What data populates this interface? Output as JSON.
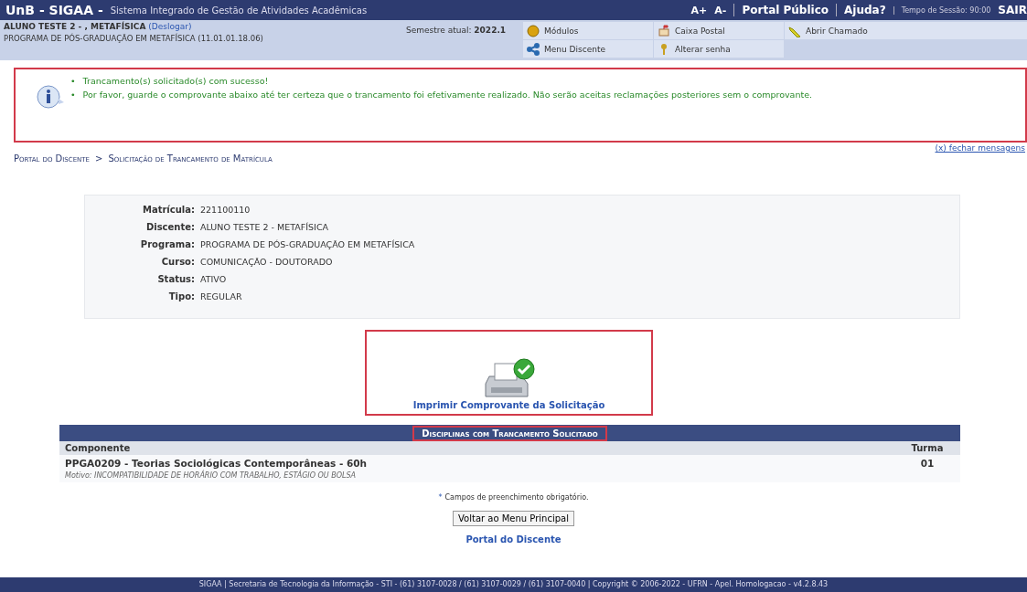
{
  "header": {
    "logo": "UnB - SIGAA -",
    "system_name": "Sistema Integrado de Gestão de Atividades Acadêmicas",
    "font_up": "A+",
    "font_down": "A-",
    "links": [
      "Portal Público",
      "Ajuda?"
    ],
    "session": "Tempo de Sessão: 90:00",
    "logout": "SAIR"
  },
  "user_bar": {
    "user": "ALUNO TESTE 2 - , METAFÍSICA",
    "logout_link": "(Deslogar)",
    "program": "PROGRAMA DE PÓS-GRADUAÇÃO EM METAFÍSICA (11.01.01.18.06)",
    "semester_label": "Semestre atual:",
    "semester": "2022.1",
    "shortcuts": [
      {
        "label": "Módulos",
        "kind": "modules"
      },
      {
        "label": "Caixa Postal",
        "kind": "mail"
      },
      {
        "label": "Abrir Chamado",
        "kind": "ticket"
      },
      {
        "label": "Menu Discente",
        "kind": "menu"
      },
      {
        "label": "Alterar senha",
        "kind": "key"
      }
    ]
  },
  "message": {
    "bullet": "•",
    "items": [
      "Trancamento(s) solicitado(s) com sucesso!",
      "Por favor, guarde o comprovante abaixo até ter certeza que o trancamento foi efetivamente realizado. Não serão aceitas reclamações posteriores sem o comprovante."
    ],
    "close": "(x) fechar mensagens"
  },
  "breadcrumb": [
    "Portal do Discente",
    "Solicitação de Trancamento de Matrícula"
  ],
  "breadcrumb_separator": ">",
  "student": [
    {
      "label": "Matrícula:",
      "value": "221100110"
    },
    {
      "label": "Discente:",
      "value": "ALUNO TESTE 2 - METAFÍSICA"
    },
    {
      "label": "Programa:",
      "value": "PROGRAMA DE PÓS-GRADUAÇÃO EM METAFÍSICA"
    },
    {
      "label": "Curso:",
      "value": "COMUNICAÇÃO - DOUTORADO"
    },
    {
      "label": "Status:",
      "value": "ATIVO"
    },
    {
      "label": "Tipo:",
      "value": "REGULAR"
    }
  ],
  "print_link": "Imprimir Comprovante da Solicitação",
  "table": {
    "caption": "Disciplinas com Trancamento Solicitado",
    "columns": [
      "Componente",
      "Turma"
    ],
    "rows": [
      {
        "component": "PPGA0209 - Teorias Sociológicas Contemporâneas - 60h",
        "class": "01",
        "reason": "Motivo: INCOMPATIBILIDADE DE HORÁRIO COM TRABALHO, ESTÁGIO OU BOLSA"
      }
    ]
  },
  "required_note": "Campos de preenchimento obrigatório.",
  "required_mark": "*",
  "back_button": "Voltar ao Menu Principal",
  "portal_link": "Portal do Discente",
  "footer": "SIGAA | Secretaria de Tecnologia da Informação - STI - (61) 3107-0028 / (61) 3107-0029 / (61) 3107-0040 | Copyright © 2006-2022 - UFRN - Apel. Homologacao - v4.2.8.43"
}
